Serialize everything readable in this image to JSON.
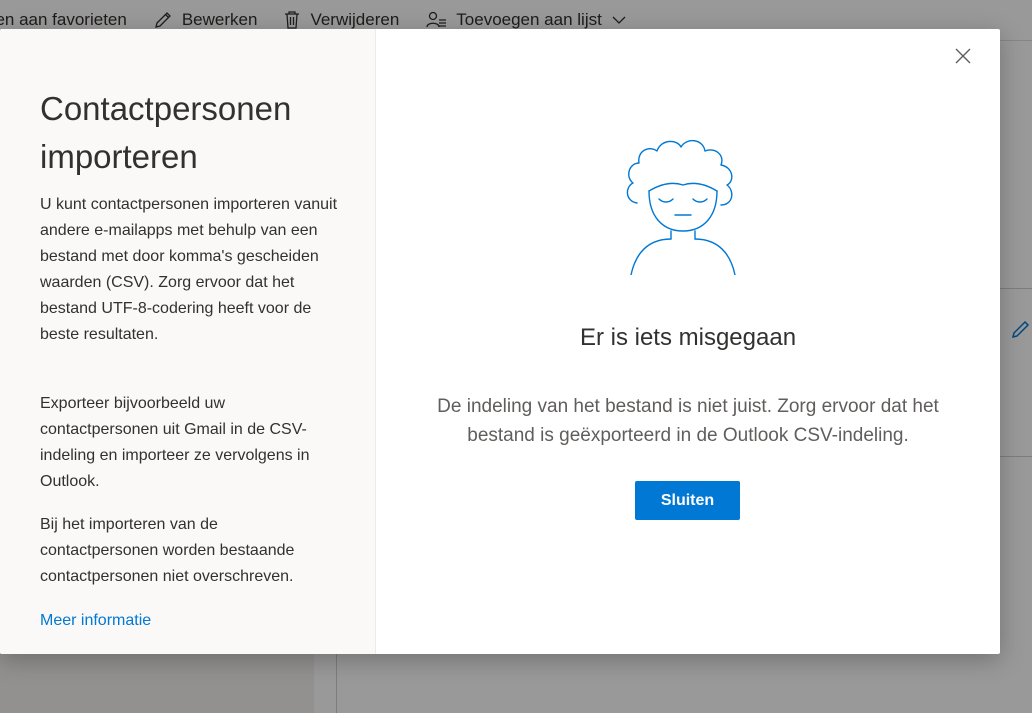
{
  "toolbar": {
    "items": [
      {
        "label": "gen aan favorieten",
        "icon": "star-icon"
      },
      {
        "label": "Bewerken",
        "icon": "pencil-icon"
      },
      {
        "label": "Verwijderen",
        "icon": "trash-icon"
      },
      {
        "label": "Toevoegen aan lijst",
        "icon": "add-to-list-icon"
      }
    ]
  },
  "dialog": {
    "side": {
      "title": "Contactpersonen importeren",
      "paragraph1": "U kunt contactpersonen importeren vanuit andere e-mailapps met behulp van een bestand met door komma's gescheiden waarden (CSV). Zorg ervoor dat het bestand UTF-8-codering heeft voor de beste resultaten.",
      "paragraph2": "Exporteer bijvoorbeeld uw contactpersonen uit Gmail in de CSV-indeling en importeer ze vervolgens in Outlook.",
      "paragraph3": "Bij het importeren van de contactpersonen worden bestaande contactpersonen niet overschreven.",
      "link": "Meer informatie"
    },
    "main": {
      "illustration": "person-illustration",
      "error_title": "Er is iets misgegaan",
      "error_text": "De indeling van het bestand is niet juist. Zorg ervoor dat het bestand is geëxporteerd in de Outlook CSV-indeling.",
      "close_button_label": "Sluiten"
    },
    "close_icon": "close-icon"
  },
  "colors": {
    "accent": "#0078d4",
    "text": "#323130",
    "secondary_text": "#605e5c",
    "side_panel_bg": "#faf9f8"
  }
}
